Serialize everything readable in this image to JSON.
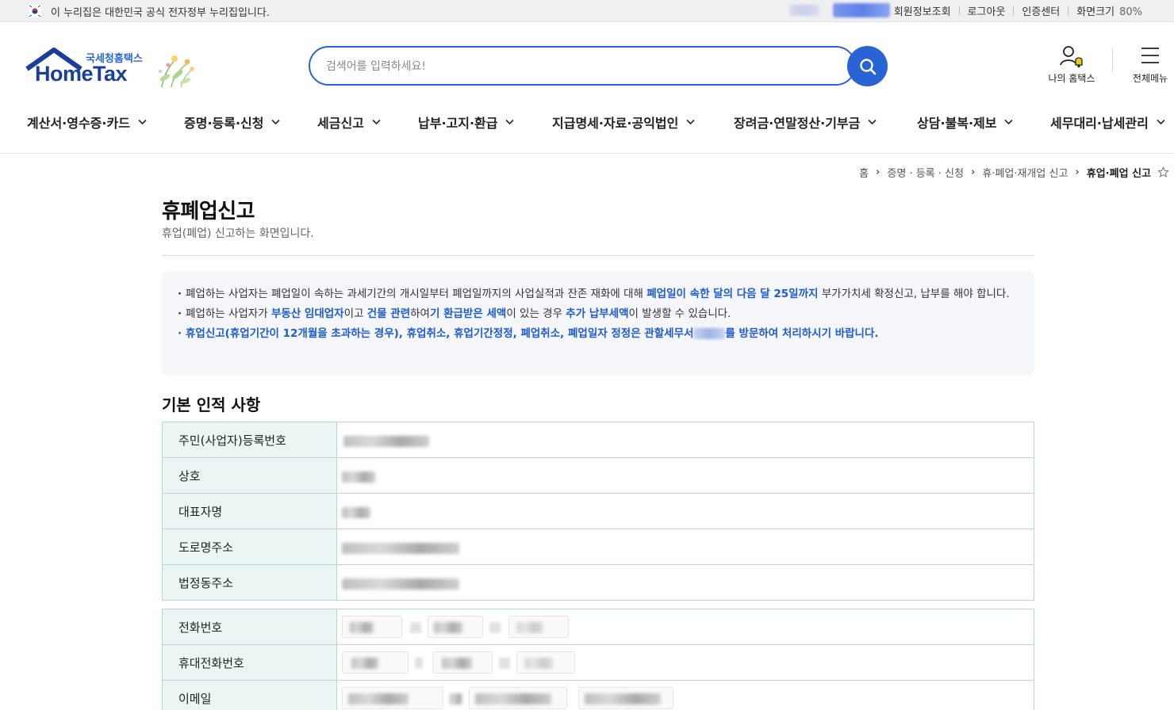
{
  "gov_bar": {
    "text": "이 누리집은 대한민국 공식 전자정부 누리집입니다.",
    "links": [
      "회원정보조회",
      "로그아웃",
      "인증센터"
    ],
    "zoom_label": "화면크기",
    "zoom_value": "80%"
  },
  "logo": {
    "subtitle": "국세청홈택스",
    "name": "HomeTax"
  },
  "search": {
    "placeholder": "검색어를 입력하세요!"
  },
  "header_actions": {
    "my_hometax": "나의 홈택스",
    "all_menu": "전체메뉴"
  },
  "gnb": [
    "계산서·영수증·카드",
    "증명·등록·신청",
    "세금신고",
    "납부·고지·환급",
    "지급명세·자료·공익법인",
    "장려금·연말정산·기부금",
    "상담·불복·제보",
    "세무대리·납세관리"
  ],
  "breadcrumb": [
    "홈",
    "증명 · 등록 · 신청",
    "휴·폐업·재개업 신고",
    "휴업·폐업 신고"
  ],
  "page": {
    "title": "휴폐업신고",
    "description": "휴업(폐업) 신고하는 화면입니다."
  },
  "notice": {
    "line1_a": "폐업하는 사업자는 폐업일이 속하는 과세기간의 개시일부터 폐업일까지의 사업실적과 잔존 재화에 대해 ",
    "line1_hl": "폐업일이 속한 달의 다음 달 25일까지",
    "line1_b": " 부가가치세 확정신고, 납부를 해야 합니다.",
    "line2_a": "폐업하는 사업자가 ",
    "line2_hl1": "부동산 임대업자",
    "line2_b": "이고 ",
    "line2_hl2": "건물 관련",
    "line2_c": "하여",
    "line2_hl3": "기 환급받은 세액",
    "line2_d": "이 있는 경우 ",
    "line2_hl4": "추가 납부세액",
    "line2_e": "이 발생할 수 있습니다.",
    "line3_a": "휴업신고(휴업기간이 12개월을 초과하는 경우), 휴업취소, 휴업기간정정, 폐업취소, 폐업일자 정정은 관할세무서",
    "line3_b": "를 방문하여 처리하시기 바랍니다."
  },
  "section": {
    "title": "기본 인적 사항"
  },
  "form_group1": [
    "주민(사업자)등록번호",
    "상호",
    "대표자명",
    "도로명주소",
    "법정동주소"
  ],
  "form_group2": [
    "전화번호",
    "휴대전화번호",
    "이메일"
  ],
  "colors": {
    "accent": "#2a63d4",
    "highlight_text": "#1f5bd4",
    "label_bg": "#eaf5f4",
    "table_border": "#b9d6d4",
    "notice_bg": "#f4f6fa"
  }
}
